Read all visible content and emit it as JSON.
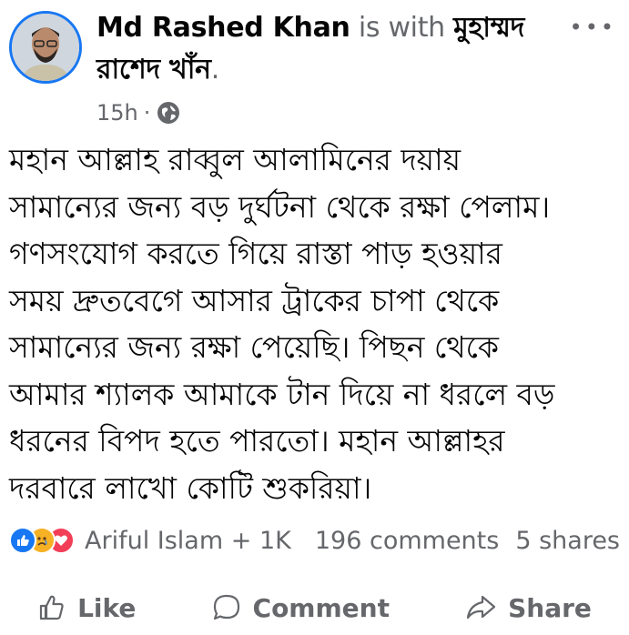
{
  "post": {
    "author": "Md Rashed Khan",
    "with_text": " is with ",
    "tagged": "মুহাম্মদ রাশেদ খাঁন",
    "tagged_suffix": ".",
    "time": "15h",
    "dot": " · ",
    "more": "•••",
    "text": "মহান আল্লাহ রাব্বুল আলামিনের দয়ায়\nসামান্যের জন্য বড় দুর্ঘটনা থেকে রক্ষা পেলাম।\nগণসংযোগ করতে গিয়ে রাস্তা পাড় হওয়ার\nসময় দ্রুতবেগে আসার ট্রাকের চাপা থেকে\nসামান্যের জন্য রক্ষা পেয়েছি। পিছন থেকে\nআমার শ্যালক আমাকে টান দিয়ে না ধরলে বড়\nধরনের বিপদ হতে পারতো। মহান আল্লাহর\nদরবারে লাখো কোটি শুকরিয়া।"
  },
  "reactions": {
    "summary": "Ariful Islam + 1K",
    "comments": "196 comments",
    "shares": "5 shares",
    "icons": [
      "like",
      "sad",
      "love"
    ]
  },
  "actions": {
    "like": "Like",
    "comment": "Comment",
    "share": "Share"
  }
}
